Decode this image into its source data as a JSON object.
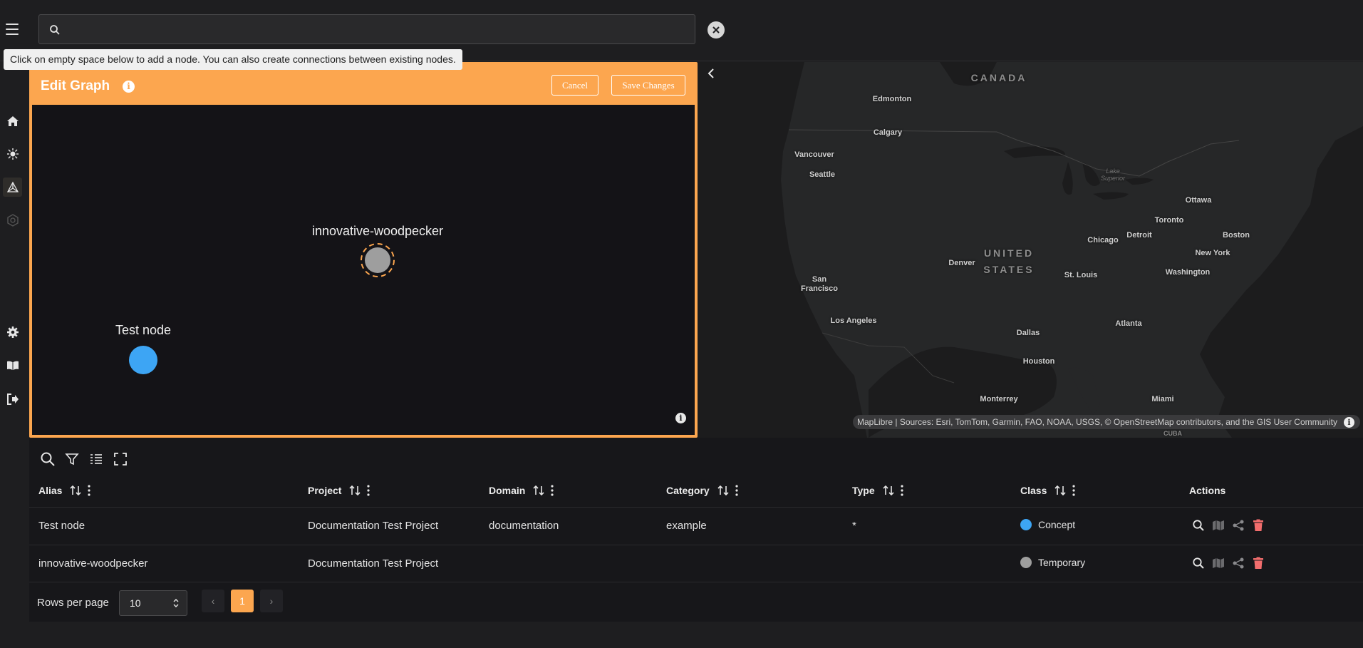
{
  "search": {
    "placeholder": "",
    "value": ""
  },
  "tooltip": "Click on empty space below to add a node. You can also create connections between existing nodes.",
  "sidebar": {
    "items": [
      {
        "icon": "home-icon"
      },
      {
        "icon": "burst-icon"
      },
      {
        "icon": "graph-icon",
        "active": true
      },
      {
        "icon": "hexagon-icon"
      },
      {
        "icon": "gear-icon"
      },
      {
        "icon": "book-icon"
      },
      {
        "icon": "logout-icon"
      }
    ]
  },
  "graph_panel": {
    "title": "Edit Graph",
    "info": "i",
    "cancel_label": "Cancel",
    "save_label": "Save Changes",
    "canvas_info": "i",
    "nodes": [
      {
        "label": "innovative-woodpecker",
        "color": "#9e9e9e",
        "selected": true
      },
      {
        "label": "Test node",
        "color": "#3da5f4",
        "selected": false
      }
    ]
  },
  "map": {
    "labels": {
      "canada": "CANADA",
      "us_line1": "UNITED",
      "us_line2": "STATES",
      "edmonton": "Edmonton",
      "calgary": "Calgary",
      "vancouver": "Vancouver",
      "seattle": "Seattle",
      "lake": "Lake Superior",
      "ottawa": "Ottawa",
      "toronto": "Toronto",
      "chicago": "Chicago",
      "detroit": "Detroit",
      "boston": "Boston",
      "newyork": "New York",
      "denver": "Denver",
      "washington": "Washington",
      "sanfrancisco": "San Francisco",
      "stlouis": "St. Louis",
      "losangeles": "Los Angeles",
      "atlanta": "Atlanta",
      "dallas": "Dallas",
      "houston": "Houston",
      "monterrey": "Monterrey",
      "miami": "Miami",
      "cuba": "CUBA"
    },
    "attribution": "MapLibre | Sources: Esri, TomTom, Garmin, FAO, NOAA, USGS, © OpenStreetMap contributors, and the GIS User Community",
    "attribution_info": "i"
  },
  "table": {
    "columns": [
      {
        "label": "Alias",
        "sortable": true
      },
      {
        "label": "Project",
        "sortable": true
      },
      {
        "label": "Domain",
        "sortable": true
      },
      {
        "label": "Category",
        "sortable": true
      },
      {
        "label": "Type",
        "sortable": true
      },
      {
        "label": "Class",
        "sortable": true
      },
      {
        "label": "Actions",
        "sortable": false
      }
    ],
    "rows": [
      {
        "alias": "Test node",
        "project": "Documentation Test Project",
        "domain": "documentation",
        "category": "example",
        "type": "*",
        "class": "Concept",
        "class_color": "#3da5f4"
      },
      {
        "alias": "innovative-woodpecker",
        "project": "Documentation Test Project",
        "domain": "",
        "category": "",
        "type": "",
        "class": "Temporary",
        "class_color": "#9e9e9e"
      }
    ]
  },
  "pagination": {
    "rows_label": "Rows per page",
    "rows_value": "10",
    "current_page": "1",
    "prev": "‹",
    "next": "›"
  },
  "colors": {
    "accent": "#fca64f",
    "delete": "#f26d6d"
  }
}
